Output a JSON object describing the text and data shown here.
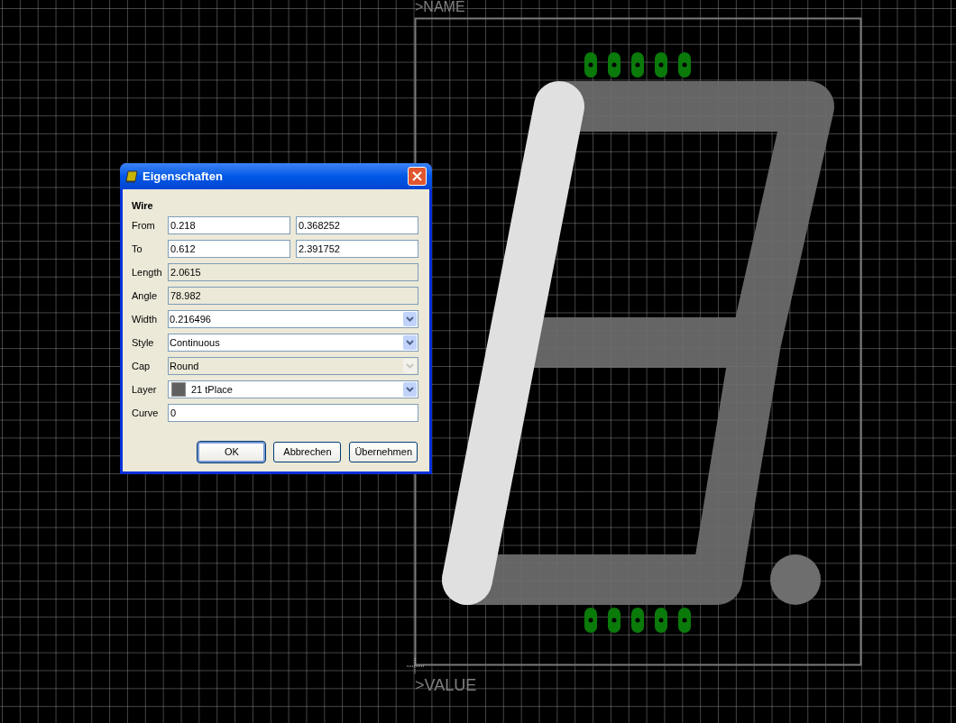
{
  "canvas": {
    "name_label": ">NAME",
    "value_label": ">VALUE"
  },
  "dialog": {
    "title": "Eigenschaften",
    "section": "Wire",
    "rows": [
      {
        "kind": "pair",
        "label": "From",
        "values": [
          "0.218",
          "0.368252"
        ]
      },
      {
        "kind": "pair",
        "label": "To",
        "values": [
          "0.612",
          "2.391752"
        ]
      },
      {
        "kind": "readonly",
        "label": "Length",
        "value": "2.0615"
      },
      {
        "kind": "readonly",
        "label": "Angle",
        "value": "78.982"
      },
      {
        "kind": "combo",
        "label": "Width",
        "value": "0.216496",
        "disabled": false
      },
      {
        "kind": "combo",
        "label": "Style",
        "value": "Continuous",
        "disabled": false
      },
      {
        "kind": "combo",
        "label": "Cap",
        "value": "Round",
        "disabled": true
      },
      {
        "kind": "layer",
        "label": "Layer",
        "value": "21 tPlace",
        "color": "#606060",
        "disabled": false
      },
      {
        "kind": "text",
        "label": "Curve",
        "value": "0"
      }
    ],
    "buttons": [
      {
        "label": "OK",
        "default": true
      },
      {
        "label": "Abbrechen",
        "default": false
      },
      {
        "label": "Übernehmen",
        "default": false
      }
    ]
  }
}
